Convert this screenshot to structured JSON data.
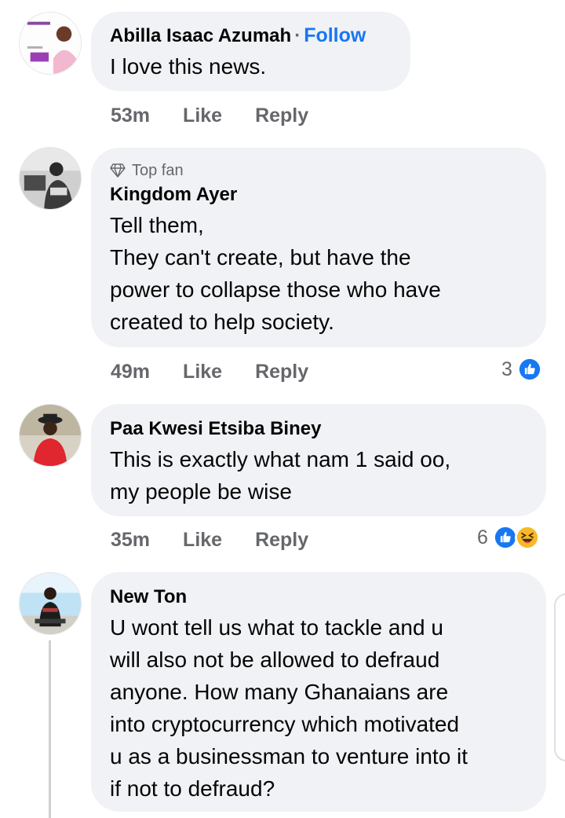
{
  "comments": [
    {
      "author": "Abilla Isaac Azumah",
      "separator": "·",
      "follow_label": "Follow",
      "text": "I love this news.",
      "time": "53m",
      "like_label": "Like",
      "reply_label": "Reply"
    },
    {
      "badge": "Top fan",
      "author": "Kingdom Ayer",
      "text_lines": [
        "Tell them,",
        "They can't create,  but have the",
        "power to  collapse those who have",
        "created to help society."
      ],
      "time": "49m",
      "like_label": "Like",
      "reply_label": "Reply",
      "reaction_count": "3",
      "reactions": [
        "like-icon"
      ]
    },
    {
      "author": "Paa Kwesi Etsiba Biney",
      "text_lines": [
        "This is exactly what nam 1 said oo,",
        "my people be wise"
      ],
      "time": "35m",
      "like_label": "Like",
      "reply_label": "Reply",
      "reaction_count": "6",
      "reactions": [
        "like-icon",
        "haha-icon"
      ]
    },
    {
      "author": "New Ton",
      "text_lines": [
        "U wont tell us what to tackle and u",
        "will also not be allowed to defraud",
        "anyone. How many Ghanaians are",
        "into cryptocurrency which motivated",
        "u as a businessman to venture into it",
        "if not to defraud?"
      ]
    }
  ],
  "colors": {
    "bubble": "#f0f2f5",
    "follow": "#1877f2",
    "meta": "#65676b",
    "like": "#1877f2",
    "haha": "#f7b928"
  }
}
